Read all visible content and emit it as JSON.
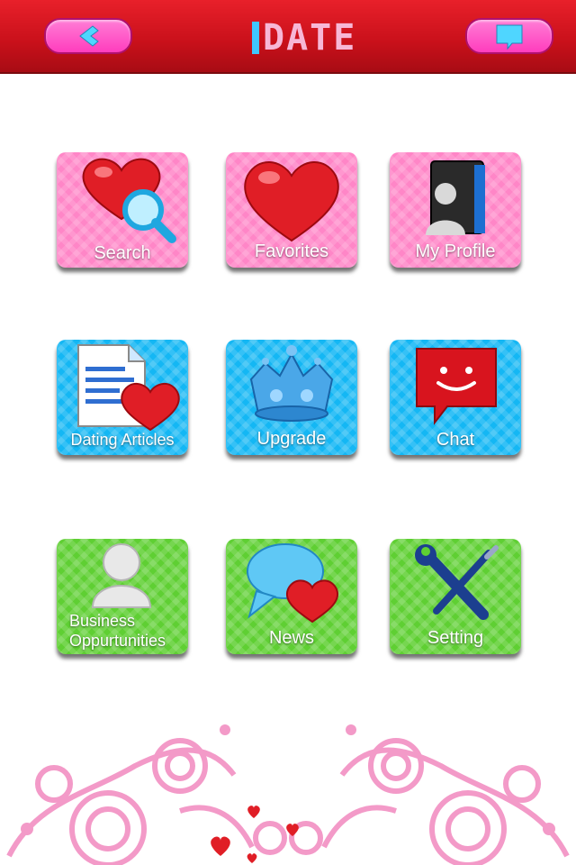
{
  "header": {
    "logo_text": "DATE",
    "back_icon": "chevron-left-icon",
    "message_icon": "speech-bubble-icon",
    "colors": {
      "bar": "#d8121c",
      "button": "#ff4fc8",
      "icon": "#4fd6ff"
    }
  },
  "menu": {
    "row1": [
      {
        "label": "Search",
        "icon": "heart-magnifier-icon",
        "color": "#ff86c7"
      },
      {
        "label": "Favorites",
        "icon": "heart-icon",
        "color": "#ff86c7"
      },
      {
        "label": "My Profile",
        "icon": "profile-folder-icon",
        "color": "#ff86c7"
      }
    ],
    "row2": [
      {
        "label": "Dating Articles",
        "icon": "document-heart-icon",
        "color": "#14b7f4"
      },
      {
        "label": "Upgrade",
        "icon": "crown-icon",
        "color": "#14b7f4"
      },
      {
        "label": "Chat",
        "icon": "smiley-chat-icon",
        "color": "#14b7f4"
      }
    ],
    "row3": [
      {
        "label_line1": "Business",
        "label_line2": "Oppurtunities",
        "icon": "user-icon",
        "color": "#5fcf33"
      },
      {
        "label": "News",
        "icon": "speech-bubble-heart-icon",
        "color": "#5fcf33"
      },
      {
        "label": "Setting",
        "icon": "wrench-screwdriver-icon",
        "color": "#5fcf33"
      }
    ]
  },
  "footer": {
    "decoration": "floral-heart-ornament"
  }
}
